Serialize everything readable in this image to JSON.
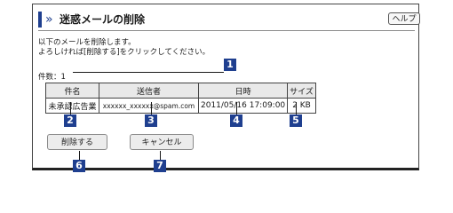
{
  "title": "迷惑メールの削除",
  "help_label": "ヘルプ",
  "instructions": [
    "以下のメールを削除します。",
    "よろしければ[削除する]をクリックしてください。"
  ],
  "count": {
    "label": "件数：",
    "value": "1"
  },
  "table": {
    "headers": [
      "件名",
      "送信者",
      "日時",
      "サイズ"
    ],
    "row": [
      "未承認広告業",
      "xxxxxx_xxxxxx@spam.com",
      "2011/05/16 17:09:00",
      "2 KB"
    ]
  },
  "buttons": {
    "delete": "削除する",
    "cancel": "キャンセル"
  },
  "callouts": [
    "1",
    "2",
    "3",
    "4",
    "5",
    "6",
    "7"
  ],
  "colors": {
    "accent": "#1f3f8f"
  },
  "icons": {
    "title": "chevron-double-right-icon"
  }
}
